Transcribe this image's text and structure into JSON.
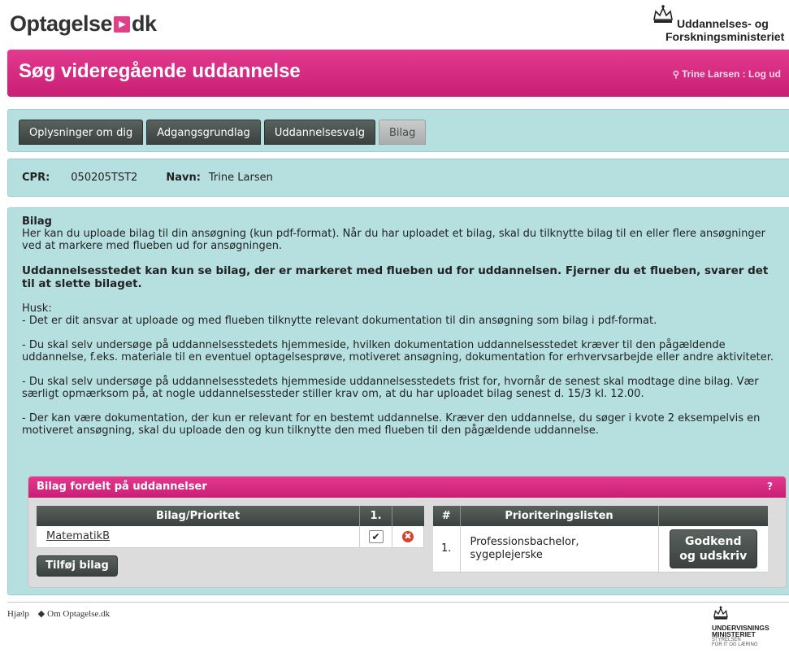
{
  "header": {
    "logo_left": "Optagelse",
    "logo_mark": "▸",
    "logo_right": "dk",
    "ministry_line1": "Uddannelses- og",
    "ministry_line2": "Forskningsministeriet"
  },
  "banner": {
    "title": "Søg videregående uddannelse",
    "user": "Trine Larsen : Log ud"
  },
  "tabs": [
    {
      "label": "Oplysninger om dig",
      "active": false
    },
    {
      "label": "Adgangsgrundlag",
      "active": false
    },
    {
      "label": "Uddannelsesvalg",
      "active": false
    },
    {
      "label": "Bilag",
      "active": true
    }
  ],
  "person": {
    "cpr_label": "CPR:",
    "cpr_value": "050205TST2",
    "name_label": "Navn:",
    "name_value": "Trine Larsen"
  },
  "main": {
    "heading": "Bilag",
    "intro": "Her kan du uploade bilag til din ansøgning (kun pdf-format). Når du har uploadet et bilag, skal du tilknytte bilag til en eller flere ansøgninger ved at markere med flueben ud for ansøgningen.",
    "warning": "Uddannelsesstedet kan kun se bilag, der er markeret med flueben ud for uddannelsen. Fjerner du et flueben, svarer det til at slette bilaget.",
    "husk": "Husk:",
    "point1": "- Det er dit ansvar at uploade og med flueben tilknytte relevant dokumentation til din ansøgning som bilag i pdf-format.",
    "point2": "- Du skal selv undersøge på uddannelsesstedets hjemmeside, hvilken dokumentation uddannelsesstedet kræver til den pågældende uddannelse, f.eks. materiale til en eventuel optagelsesprøve, motiveret ansøgning, dokumentation for erhvervsarbejde eller andre aktiviteter.",
    "point3": "- Du skal selv undersøge på uddannelsesstedets hjemmeside uddannelsesstedets frist for, hvornår de senest skal modtage dine bilag. Vær særligt opmærksom på, at nogle uddannelsessteder stiller krav om, at du har uploadet bilag senest d. 15/3 kl. 12.00.",
    "point4": "- Der kan være dokumentation, der kun er relevant for en bestemt uddannelse. Kræver den uddannelse, du søger i kvote 2 eksempelvis en motiveret ansøgning, skal du uploade den og kun tilknytte den med flueben til den pågældende uddannelse."
  },
  "bilag_panel": {
    "title": "Bilag fordelt på uddannelser",
    "help": "?",
    "table1": {
      "headers": [
        "Bilag/Prioritet",
        "1.",
        ""
      ],
      "rows": [
        {
          "name": "MatematikB",
          "checked": "✔",
          "delete": "✖"
        }
      ]
    },
    "add_button": "Tilføj bilag",
    "table2": {
      "headers": [
        "#",
        "Prioriteringslisten",
        ""
      ],
      "rows": [
        {
          "num": "1.",
          "program_line1": "Professionsbachelor,",
          "program_line2": "sygeplejerske"
        }
      ]
    },
    "approve_line1": "Godkend",
    "approve_line2": "og udskriv"
  },
  "footer": {
    "help": "Hjælp",
    "about": "Om Optagelse.dk",
    "uvm_line1": "UNDERVISNINGS",
    "uvm_line2": "MINISTERIET",
    "uvm_line3": "STYRELSEN",
    "uvm_line4": "FOR IT OG LÆRING"
  },
  "colors": {
    "brand_pink": "#d42c82",
    "panel_teal": "#b6dfe0",
    "dark_button": "#454c49"
  }
}
